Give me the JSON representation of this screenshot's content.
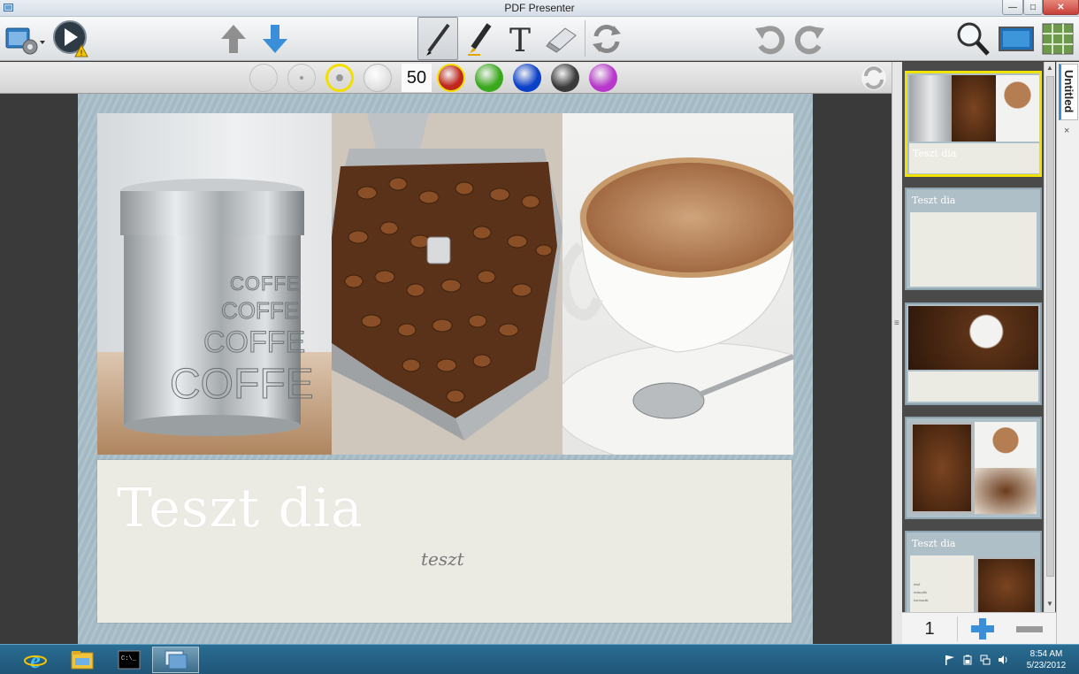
{
  "window": {
    "title": "PDF Presenter"
  },
  "toolbar": {
    "buttons": [
      "settings-menu",
      "play-presentation",
      "previous-slide",
      "next-slide",
      "pen-tool",
      "marker-tool",
      "text-tool",
      "eraser-tool",
      "swap",
      "undo",
      "redo",
      "zoom",
      "single-screen-view",
      "grid-view"
    ],
    "warning": true
  },
  "colorbar": {
    "pen_size": "50",
    "colors": [
      "#c0281e",
      "#3aa81c",
      "#0a3fc8",
      "#3a3a3a",
      "#b637c9"
    ]
  },
  "slide": {
    "title": "Teszt dia",
    "subtitle": "teszt"
  },
  "thumbnails": {
    "items": [
      {
        "caption": "Teszt dia",
        "selected": true
      },
      {
        "caption": "Teszt dia",
        "selected": false
      },
      {
        "caption": "",
        "selected": false
      },
      {
        "caption": "",
        "selected": false
      },
      {
        "caption": "Teszt dia",
        "selected": false,
        "bullets": [
          "első",
          "második",
          "harmadik"
        ]
      }
    ],
    "page_number": "1"
  },
  "document_tab": {
    "label": "Untitled",
    "close": "×"
  },
  "taskbar": {
    "time": "8:54 AM",
    "date": "5/23/2012"
  }
}
